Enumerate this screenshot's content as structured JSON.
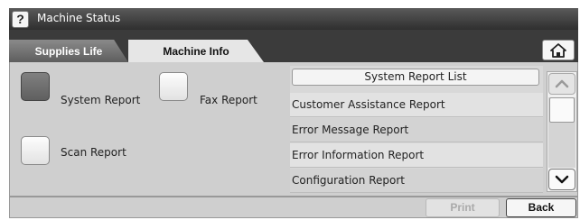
{
  "window": {
    "title": "Machine Status",
    "help_label": "?"
  },
  "tabs": [
    {
      "label": "Supplies Life",
      "active": false
    },
    {
      "label": "Machine Info",
      "active": true
    }
  ],
  "reports": {
    "system": {
      "label": "System Report",
      "selected": true
    },
    "fax": {
      "label": "Fax Report",
      "selected": false
    },
    "scan": {
      "label": "Scan Report",
      "selected": false
    }
  },
  "list": {
    "header": "System Report List",
    "items": [
      "Customer Assistance Report",
      "Error Message Report",
      "Error Information Report",
      "Configuration Report"
    ]
  },
  "footer": {
    "print_label": "Print",
    "back_label": "Back",
    "print_enabled": false
  },
  "colors": {
    "title_bar": "#2f2f2f",
    "tab_active": "#e6e6e6",
    "panel": "#cfcfcf",
    "selected_button": "#6a6a6a"
  },
  "icons": {
    "home": "home-icon",
    "scroll_up": "chevron-up-icon",
    "scroll_down": "chevron-down-icon"
  }
}
